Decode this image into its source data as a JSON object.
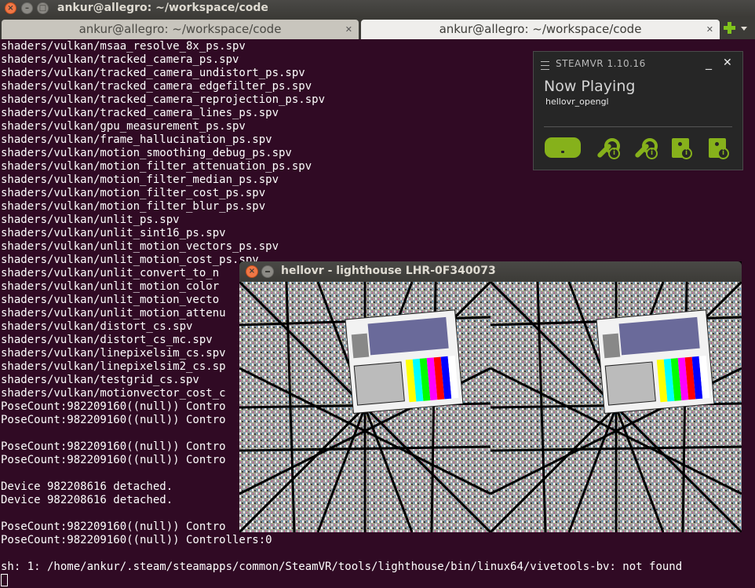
{
  "window": {
    "title": "ankur@allegro: ~/workspace/code"
  },
  "tabs": [
    {
      "label": "ankur@allegro: ~/workspace/code",
      "active": false
    },
    {
      "label": "ankur@allegro: ~/workspace/code",
      "active": true
    }
  ],
  "terminal": {
    "lines": [
      "shaders/vulkan/msaa_resolve_8x_ps.spv",
      "shaders/vulkan/tracked_camera_ps.spv",
      "shaders/vulkan/tracked_camera_undistort_ps.spv",
      "shaders/vulkan/tracked_camera_edgefilter_ps.spv",
      "shaders/vulkan/tracked_camera_reprojection_ps.spv",
      "shaders/vulkan/tracked_camera_lines_ps.spv",
      "shaders/vulkan/gpu_measurement_ps.spv",
      "shaders/vulkan/frame_hallucination_ps.spv",
      "shaders/vulkan/motion_smoothing_debug_ps.spv",
      "shaders/vulkan/motion_filter_attenuation_ps.spv",
      "shaders/vulkan/motion_filter_median_ps.spv",
      "shaders/vulkan/motion_filter_cost_ps.spv",
      "shaders/vulkan/motion_filter_blur_ps.spv",
      "shaders/vulkan/unlit_ps.spv",
      "shaders/vulkan/unlit_sint16_ps.spv",
      "shaders/vulkan/unlit_motion_vectors_ps.spv",
      "shaders/vulkan/unlit_motion_cost_ps.spv",
      "shaders/vulkan/unlit_convert_to_n",
      "shaders/vulkan/unlit_motion_color",
      "shaders/vulkan/unlit_motion_vecto",
      "shaders/vulkan/unlit_motion_attenu",
      "shaders/vulkan/distort_cs.spv",
      "shaders/vulkan/distort_cs_mc.spv",
      "shaders/vulkan/linepixelsim_cs.spv",
      "shaders/vulkan/linepixelsim2_cs.sp",
      "shaders/vulkan/testgrid_cs.spv",
      "shaders/vulkan/motionvector_cost_c",
      "PoseCount:982209160((null)) Contro",
      "PoseCount:982209160((null)) Contro",
      "",
      "PoseCount:982209160((null)) Contro",
      "PoseCount:982209160((null)) Contro",
      "",
      "Device 982208616 detached.",
      "Device 982208616 detached.",
      "",
      "PoseCount:982209160((null)) Contro",
      "PoseCount:982209160((null)) Controllers:0",
      "",
      "sh: 1: /home/ankur/.steam/steamapps/common/SteamVR/tools/lighthouse/bin/linux64/vivetools-bv: not found"
    ]
  },
  "steamvr": {
    "title": "STEAMVR 1.10.16",
    "minimize": "_",
    "close": "✕",
    "now_playing": "Now Playing",
    "app": "hellovr_opengl",
    "accent": "#86b11b",
    "devices": [
      "headset-icon",
      "controller-icon",
      "controller-icon",
      "base-station-icon",
      "base-station-icon"
    ]
  },
  "vrwindow": {
    "title": "hellovr - lighthouse LHR-0F340073"
  }
}
